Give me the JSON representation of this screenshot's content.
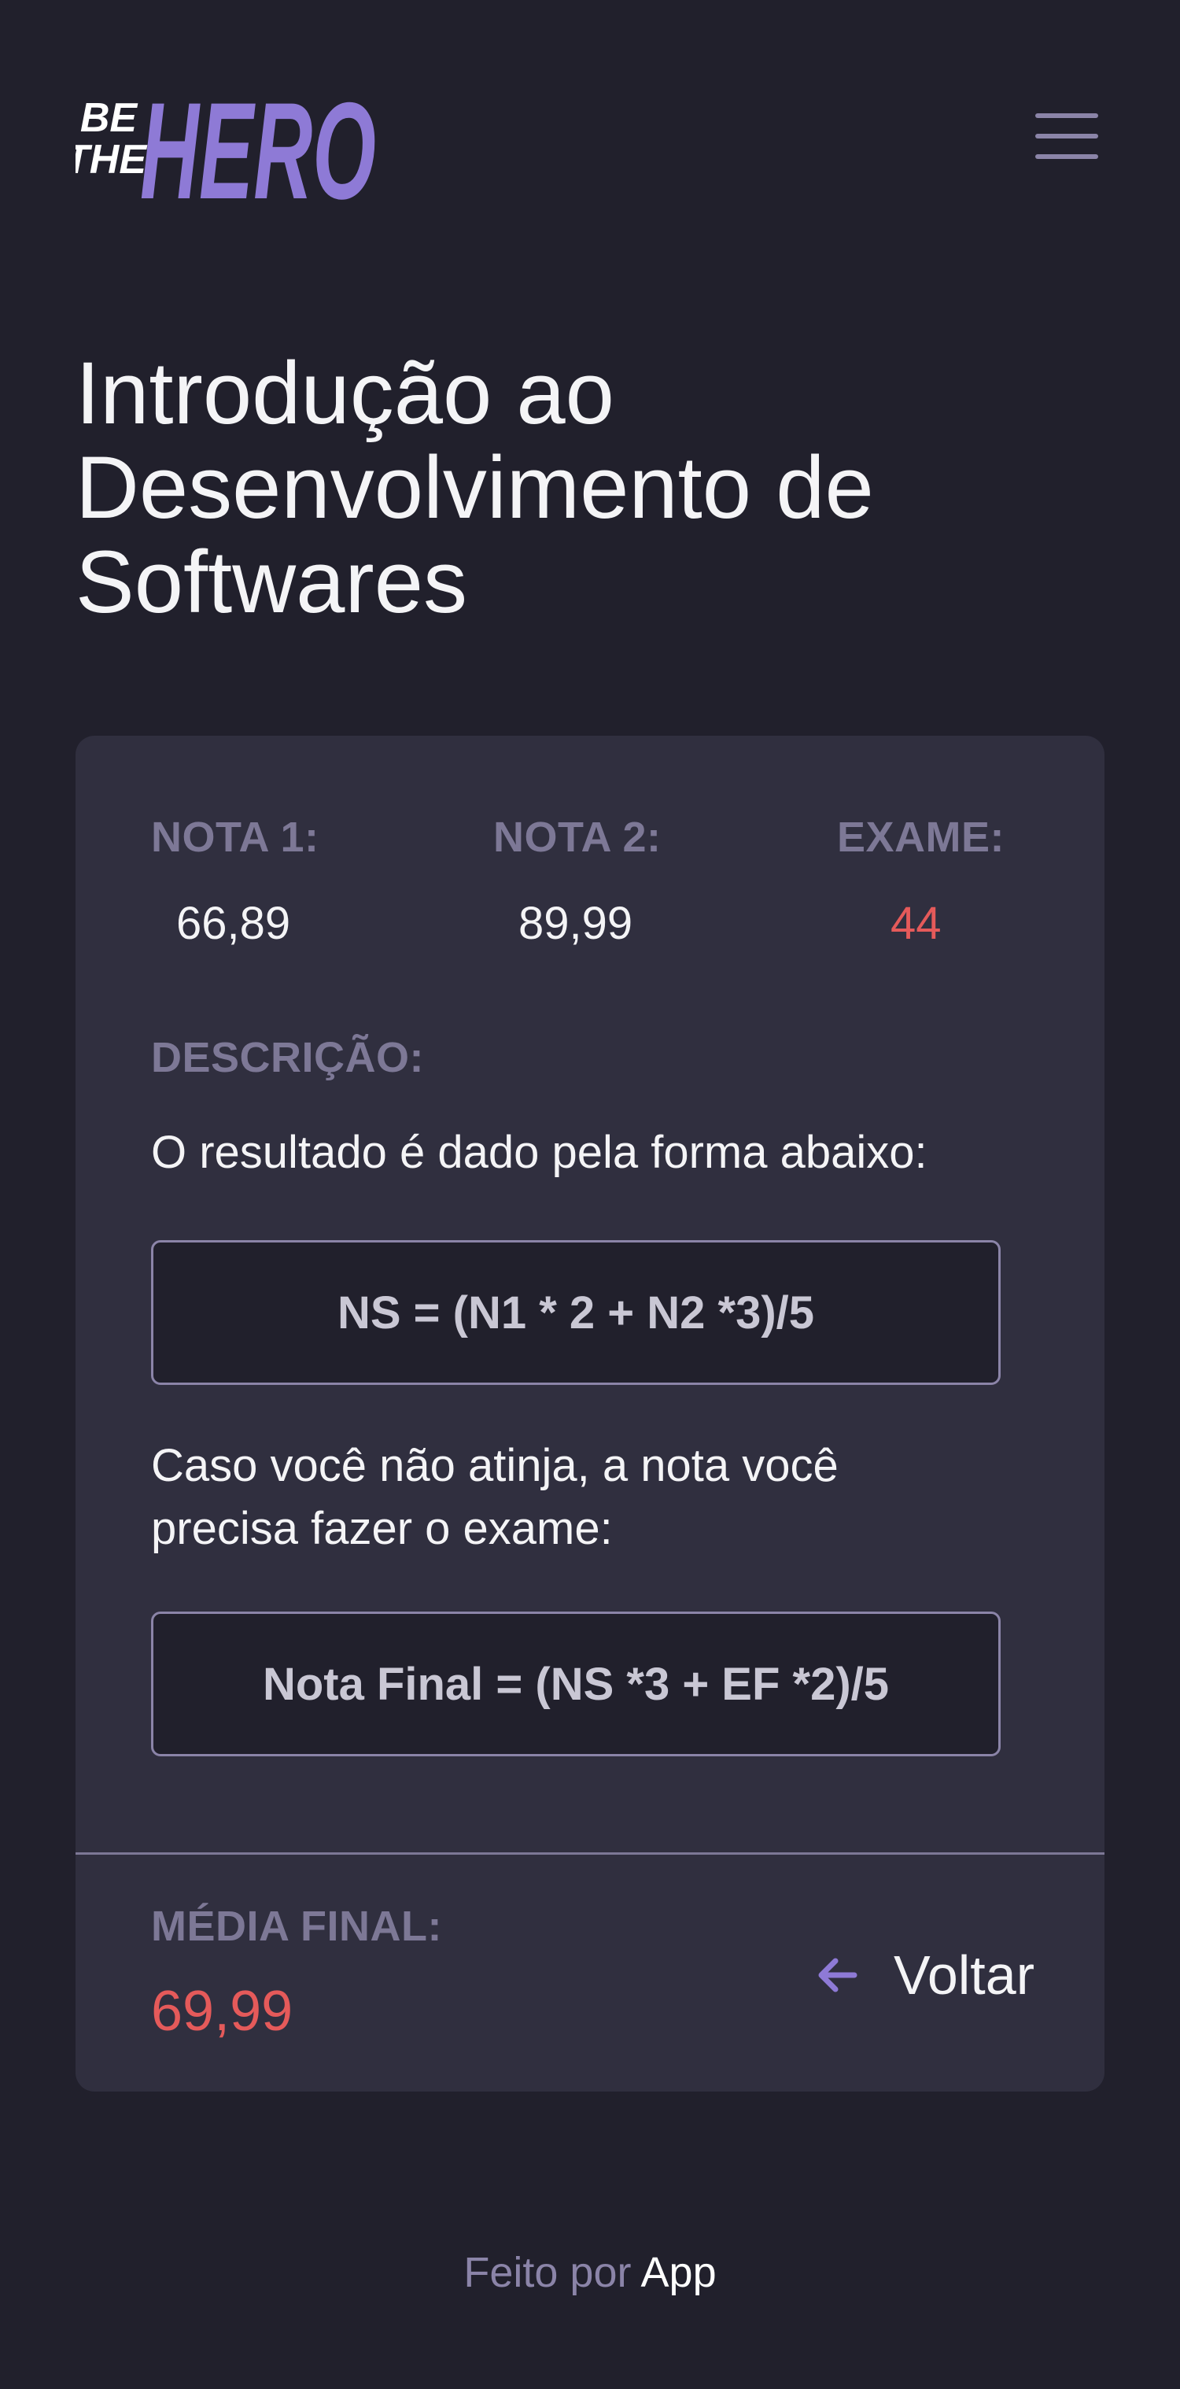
{
  "header": {
    "logo_text": "BE THE HERO"
  },
  "page": {
    "title": "Introdução ao Desenvolvimento de Softwares"
  },
  "grades": {
    "nota1_label": "NOTA 1:",
    "nota1_value": "66,89",
    "nota2_label": "NOTA 2:",
    "nota2_value": "89,99",
    "exame_label": "EXAME:",
    "exame_value": "44"
  },
  "description": {
    "label": "DESCRIÇÃO:",
    "intro": "O resultado é dado pela forma abaixo:",
    "formula1": "NS = (N1 * 2 + N2 *3)/5",
    "exam_text": "Caso você não atinja, a nota você precisa fazer o exame:",
    "formula2": "Nota Final = (NS *3 + EF *2)/5"
  },
  "result": {
    "label": "MÉDIA FINAL:",
    "value": "69,99",
    "back_label": "Voltar"
  },
  "footer": {
    "prefix": "Feito por",
    "brand": "App"
  },
  "colors": {
    "background": "#21202c",
    "card": "#302f3f",
    "accent_purple": "#8e7ad6",
    "label_gray": "#7d7896",
    "alert_red": "#e55a5a"
  }
}
